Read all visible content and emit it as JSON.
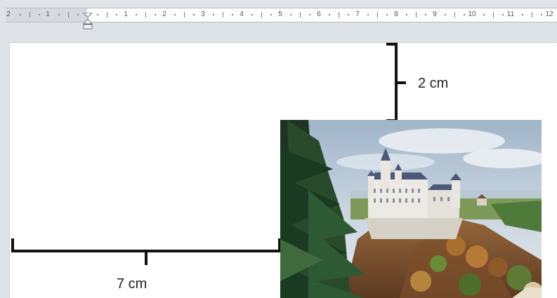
{
  "ruler": {
    "left_numbers": [
      "2",
      "1"
    ],
    "right_numbers": [
      "1",
      "2",
      "3",
      "4",
      "5",
      "6",
      "7",
      "8",
      "9",
      "10",
      "11",
      "12"
    ]
  },
  "annotations": {
    "vertical_distance": "2 cm",
    "horizontal_distance": "7 cm"
  },
  "image": {
    "subject_icon": "castle-photo"
  },
  "colors": {
    "workspace": "#dfe3e8",
    "page": "#ffffff",
    "bracket": "#111111"
  }
}
